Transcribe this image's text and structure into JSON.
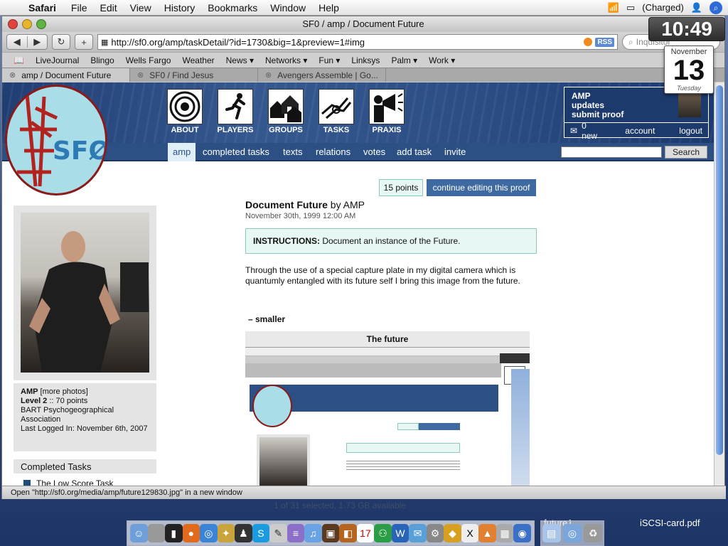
{
  "menubar": {
    "app": "Safari",
    "items": [
      "File",
      "Edit",
      "View",
      "History",
      "Bookmarks",
      "Window",
      "Help"
    ],
    "battery": "(Charged)"
  },
  "window": {
    "title": "SF0 / amp / Document Future",
    "url": "http://sf0.org/amp/taskDetail/?id=1730&big=1&preview=1#img",
    "rss": "RSS",
    "search_placeholder": "Inquisitor",
    "bookmarks": [
      "LiveJournal",
      "Blingo",
      "Wells Fargo",
      "Weather",
      "News ▾",
      "Networks ▾",
      "Fun ▾",
      "Linksys",
      "Palm ▾",
      "Work ▾"
    ],
    "tabs": [
      {
        "label": "amp / Document Future"
      },
      {
        "label": "SF0 / Find Jesus"
      },
      {
        "label": "Avengers Assemble | Go..."
      }
    ],
    "status": "Open \"http://sf0.org/media/amp/future129830.jpg\" in a new window"
  },
  "site": {
    "logo_text": "SFØ",
    "nav_icons": [
      {
        "label": "ABOUT",
        "icon": "target-icon"
      },
      {
        "label": "PLAYERS",
        "icon": "runner-icon"
      },
      {
        "label": "GROUPS",
        "icon": "houses-icon"
      },
      {
        "label": "TASKS",
        "icon": "handshake-icon"
      },
      {
        "label": "PRAXIS",
        "icon": "megaphone-icon"
      }
    ],
    "userbox": {
      "name": "AMP",
      "updates": "updates",
      "submit": "submit proof",
      "new": "0 new",
      "account": "account",
      "logout": "logout"
    },
    "navbar": [
      "amp",
      "completed tasks",
      "texts",
      "relations",
      "votes",
      "add task",
      "invite"
    ],
    "search_button": "Search"
  },
  "task": {
    "points": "15 points",
    "edit": "continue editing this proof",
    "title": "Document Future",
    "by": "by AMP",
    "date": "November 30th, 1999 12:00 AM",
    "instructions_label": "INSTRUCTIONS:",
    "instructions": "Document an instance of the Future.",
    "description": "Through the use of a special capture plate in my digital camera which is quantumly entangled with its future self I bring this image from the future.",
    "smaller": "– smaller",
    "image_caption": "The future"
  },
  "profile": {
    "name": "AMP",
    "more": "[more photos]",
    "level": "Level 2",
    "points": ":: 70 points",
    "group": "BART Psychogeographical Association",
    "last_login": "Last Logged In: November 6th, 2007",
    "completed_heading": "Completed Tasks",
    "first_task": "The Low Score Task"
  },
  "widgets": {
    "time": "10:49",
    "month": "November",
    "day": "13",
    "weekday": "Tuesday"
  },
  "desktop": {
    "finder_status": "1 of 31 selected, 1.73 GB available",
    "folder": "future1",
    "file": "iSCSI-card.pdf"
  }
}
